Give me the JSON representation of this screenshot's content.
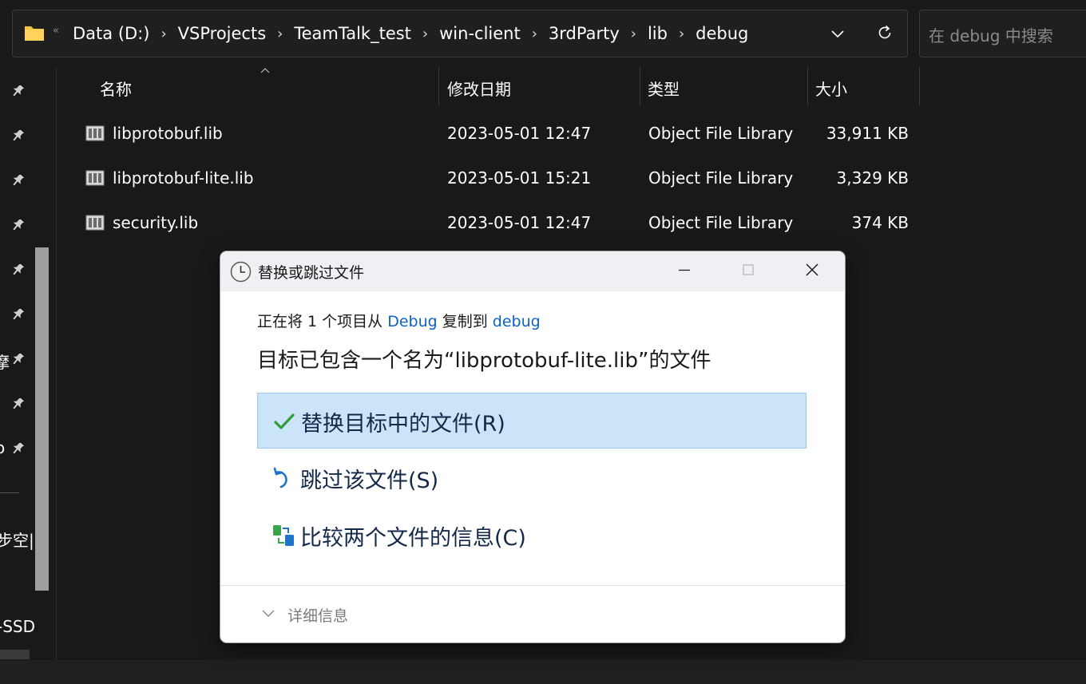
{
  "address_bar": {
    "overflow_glyph": "«",
    "crumbs": [
      "Data (D:)",
      "VSProjects",
      "TeamTalk_test",
      "win-client",
      "3rdParty",
      "lib",
      "debug"
    ],
    "separator": "›"
  },
  "search": {
    "placeholder": "在 debug 中搜索"
  },
  "nav": {
    "fragments": [
      "摩",
      "o",
      "步空|",
      "-SSD"
    ],
    "pin_icon": "pin-icon"
  },
  "columns": {
    "name": "名称",
    "date": "修改日期",
    "type": "类型",
    "size": "大小"
  },
  "files": [
    {
      "name": "libprotobuf.lib",
      "date": "2023-05-01 12:47",
      "type": "Object File Library",
      "size": "33,911 KB"
    },
    {
      "name": "libprotobuf-lite.lib",
      "date": "2023-05-01 15:21",
      "type": "Object File Library",
      "size": "3,329 KB"
    },
    {
      "name": "security.lib",
      "date": "2023-05-01 12:47",
      "type": "Object File Library",
      "size": "374 KB"
    }
  ],
  "dialog": {
    "title": "替换或跳过文件",
    "subtitle_prefix": "正在将 1 个项目从 ",
    "source": "Debug",
    "subtitle_mid": " 复制到 ",
    "dest": "debug",
    "heading": "目标已包含一个名为“libprotobuf-lite.lib”的文件",
    "options": [
      {
        "label": "替换目标中的文件(R)",
        "icon": "checkmark-icon",
        "selected": true
      },
      {
        "label": "跳过该文件(S)",
        "icon": "undo-arrow-icon",
        "selected": false
      },
      {
        "label": "比较两个文件的信息(C)",
        "icon": "compare-icon",
        "selected": false
      }
    ],
    "more_details": "详细信息"
  },
  "colors": {
    "accent_link": "#0b63c4",
    "selected_bg": "#cce4f7",
    "selected_border": "#99c9ef",
    "background": "#191919"
  }
}
